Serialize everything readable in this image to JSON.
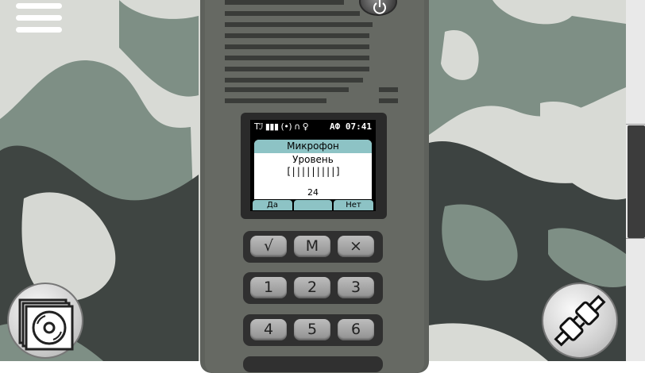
{
  "status_bar": {
    "icons": "Tℐ ▮▮▮ (•) ∩ ♀",
    "mode": "АФ",
    "time": "07:41"
  },
  "screen": {
    "title": "Микрофон",
    "label": "Уровень",
    "level_bar": "[|||||||||]",
    "value": "24",
    "level_fraction": 1.0
  },
  "softkeys": {
    "left": "Да",
    "middle": "",
    "right": "Нет"
  },
  "keypad": {
    "row1": [
      "√",
      "M",
      "×"
    ],
    "row2": [
      "1",
      "2",
      "3"
    ],
    "row3": [
      "4",
      "5",
      "6"
    ]
  },
  "icons": {
    "menu": "hamburger-menu-icon",
    "power": "power-icon",
    "disc": "disc-stack-icon",
    "plug": "plug-connect-icon"
  },
  "colors": {
    "radio_body": "#636660",
    "accent": "#8dc3c5",
    "camo_light": "#d9dbd6",
    "camo_mid": "#7e8f85",
    "camo_dark": "#3d4341"
  }
}
